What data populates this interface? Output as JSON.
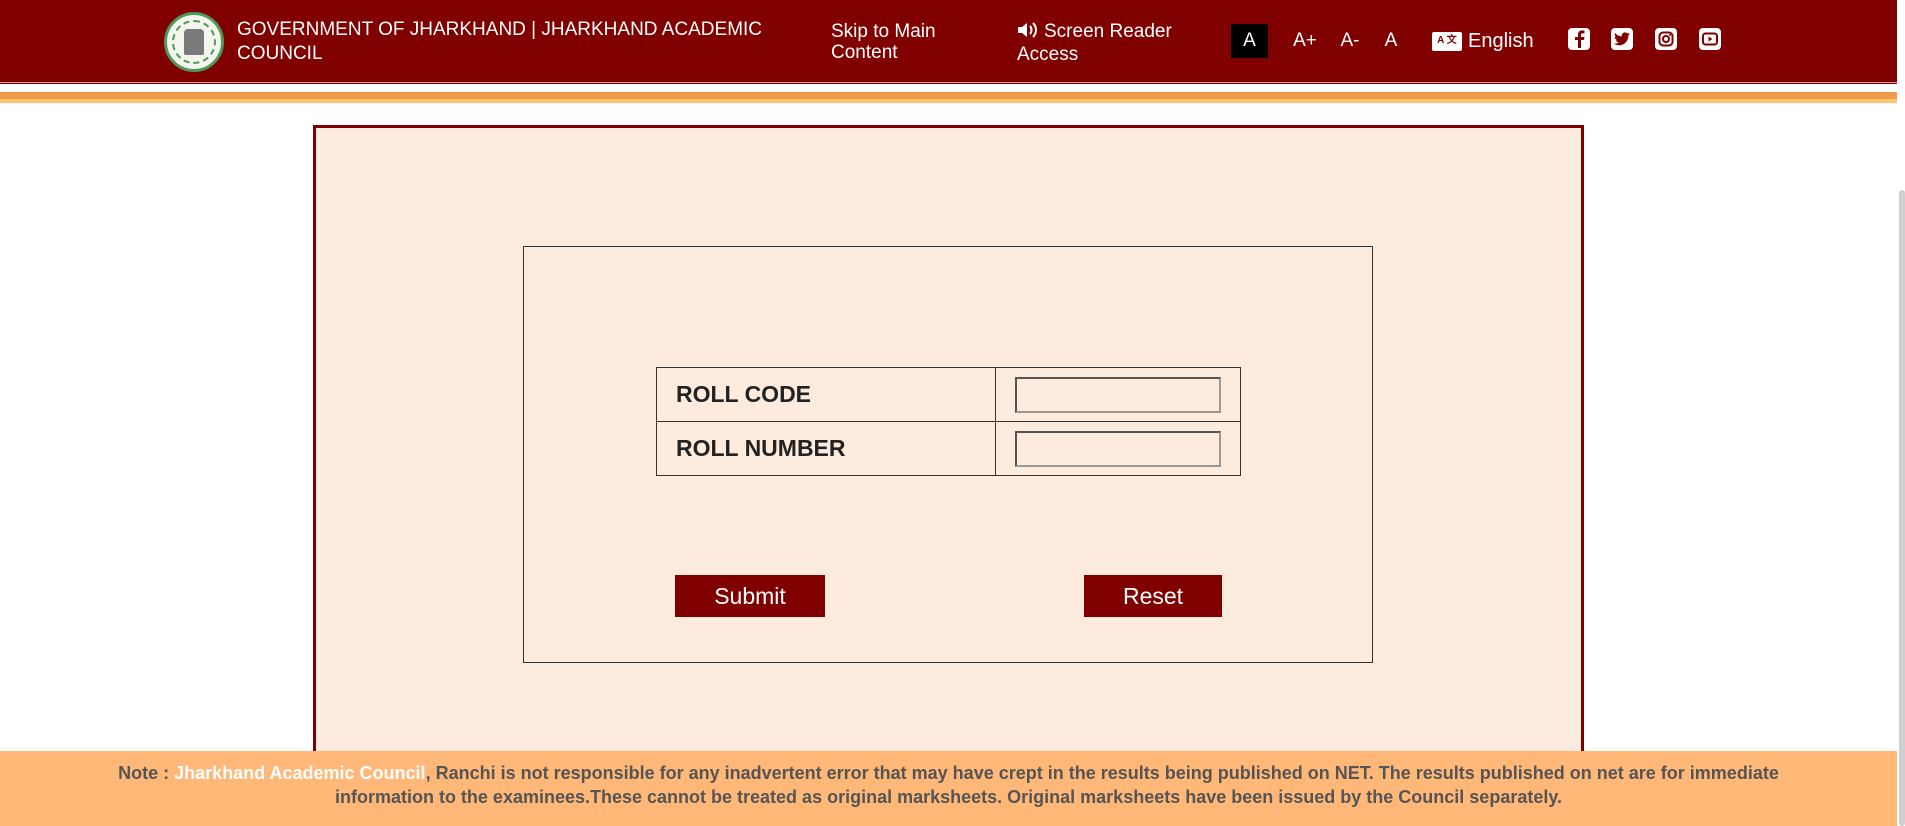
{
  "header": {
    "title": "GOVERNMENT OF JHARKHAND | JHARKHAND ACADEMIC COUNCIL",
    "skip_link": "Skip to Main Content",
    "screen_reader": "Screen Reader Access",
    "font_sizes": {
      "active": "A",
      "increase": "A+",
      "decrease": "A-",
      "normal": "A"
    },
    "language": {
      "icon_text": "A 文",
      "label": "English"
    },
    "social": [
      "facebook-icon",
      "twitter-icon",
      "instagram-icon",
      "youtube-icon"
    ]
  },
  "form": {
    "rows": [
      {
        "label": "ROLL CODE",
        "value": ""
      },
      {
        "label": "ROLL NUMBER",
        "value": ""
      }
    ],
    "submit_label": "Submit",
    "reset_label": "Reset"
  },
  "note": {
    "prefix": "Note : ",
    "highlight": "Jharkhand Academic Council",
    "text": ", Ranchi is not responsible for any inadvertent error that may have crept in the results being published on NET. The results published on net are for immediate information to the examinees.These cannot be treated as original marksheets. Original marksheets have been issued by the Council separately."
  },
  "colors": {
    "header_bg": "#800000",
    "panel_bg": "#fdebdd",
    "note_bg": "#ffb878",
    "stripe_orange": "#f2994a",
    "stripe_yellow": "#ffc470"
  }
}
